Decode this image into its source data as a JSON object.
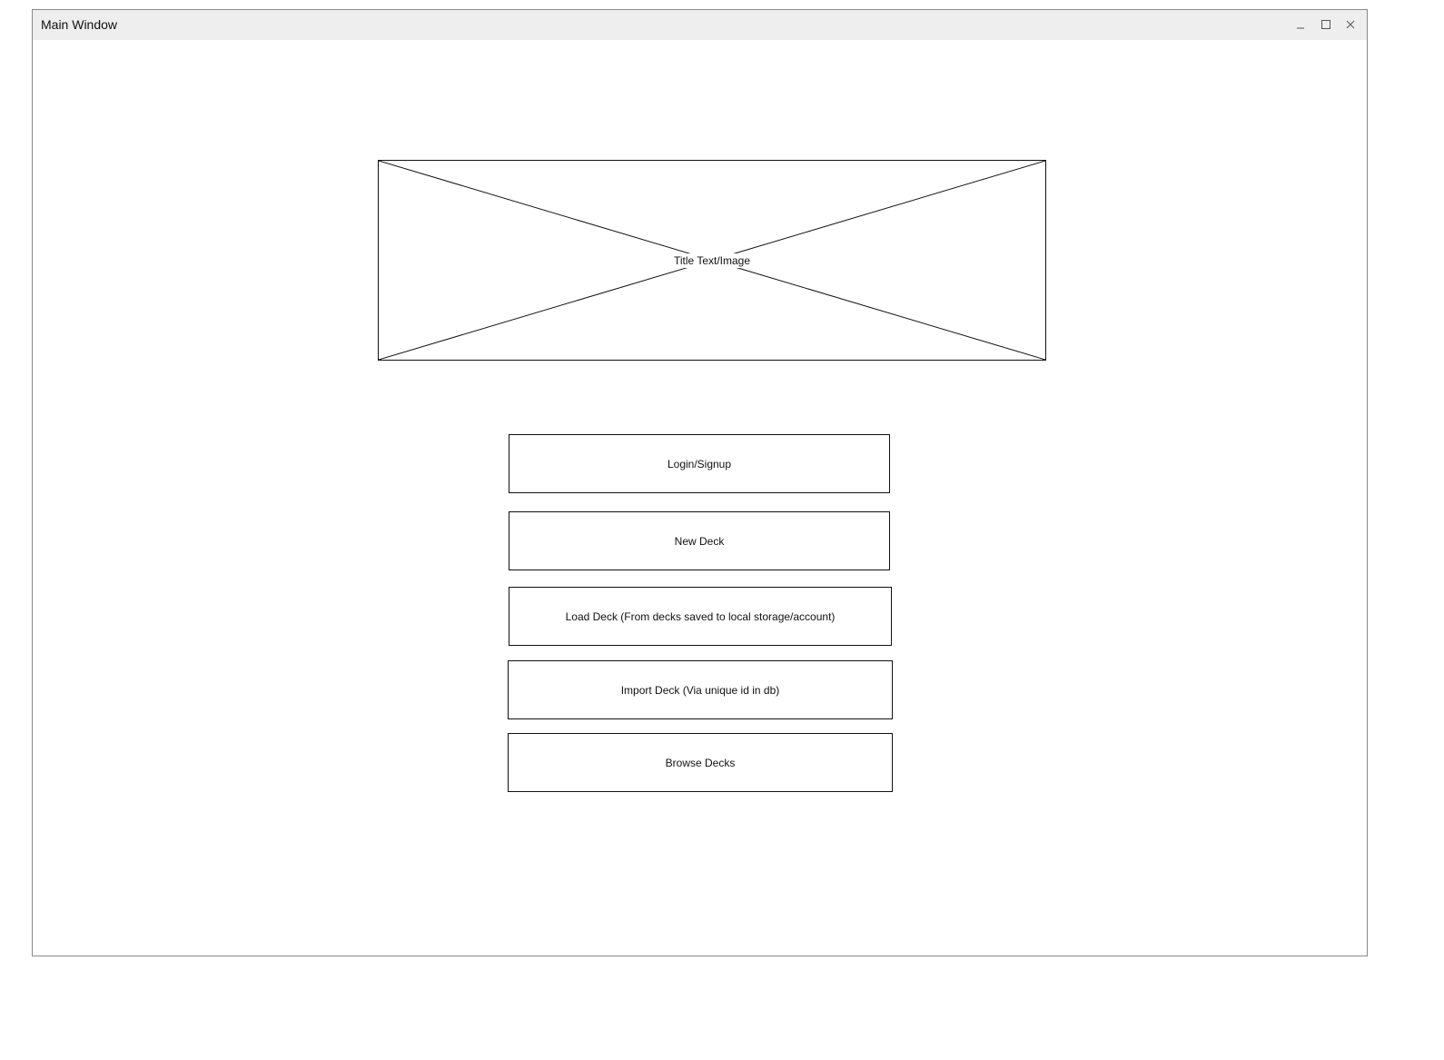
{
  "window": {
    "title": "Main Window",
    "controls": {
      "minimize_icon": "minimize-icon",
      "maximize_icon": "maximize-icon",
      "close_icon": "close-icon"
    }
  },
  "hero": {
    "label": "Title Text/Image"
  },
  "menu": {
    "buttons": [
      {
        "label": "Login/Signup"
      },
      {
        "label": "New Deck"
      },
      {
        "label": "Load Deck (From decks saved to local storage/account)"
      },
      {
        "label": "Import Deck (Via unique id in db)"
      },
      {
        "label": "Browse Decks"
      }
    ]
  },
  "colors": {
    "titlebar": "#eeeeee",
    "border": "#111111",
    "window_border": "#8a8a8a"
  }
}
